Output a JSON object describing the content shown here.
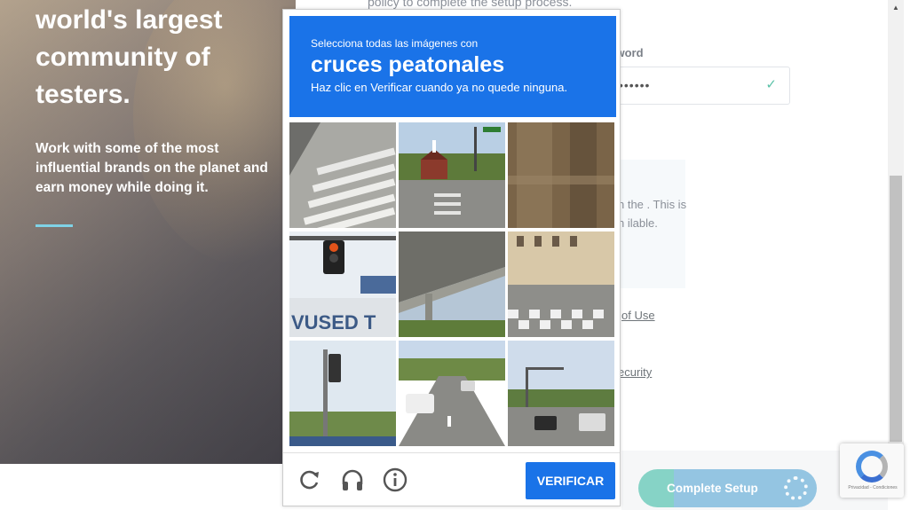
{
  "hero": {
    "title": "world's largest community of testers.",
    "text": "Work with some of the most influential brands on the planet and earn money while doing it."
  },
  "form": {
    "top_text": "policy to complete the setup process.",
    "confirm_label": "irm password",
    "password_value": "••••••",
    "note_text": "n the . This is n ilable.",
    "terms_link": "of Use",
    "security_link": "ecurity",
    "complete_button": "Complete Setup"
  },
  "captcha": {
    "instruction_small": "Selecciona todas las imágenes con",
    "instruction_big": "cruces peatonales",
    "instruction_hint": "Haz clic en Verificar cuando ya no quede ninguna.",
    "verify_label": "VERIFICAR",
    "tiles": [
      {
        "name": "crosswalk-road"
      },
      {
        "name": "church-street"
      },
      {
        "name": "blurred-wall"
      },
      {
        "name": "traffic-light-sign"
      },
      {
        "name": "overpass"
      },
      {
        "name": "city-crosswalk"
      },
      {
        "name": "traffic-signal-pole"
      },
      {
        "name": "highway-cars"
      },
      {
        "name": "intersection"
      }
    ]
  },
  "recaptcha_badge": {
    "text": "Privacidad - Condiciones"
  },
  "colors": {
    "captcha_blue": "#1a73e8",
    "accent_teal": "#7fd2e6"
  }
}
